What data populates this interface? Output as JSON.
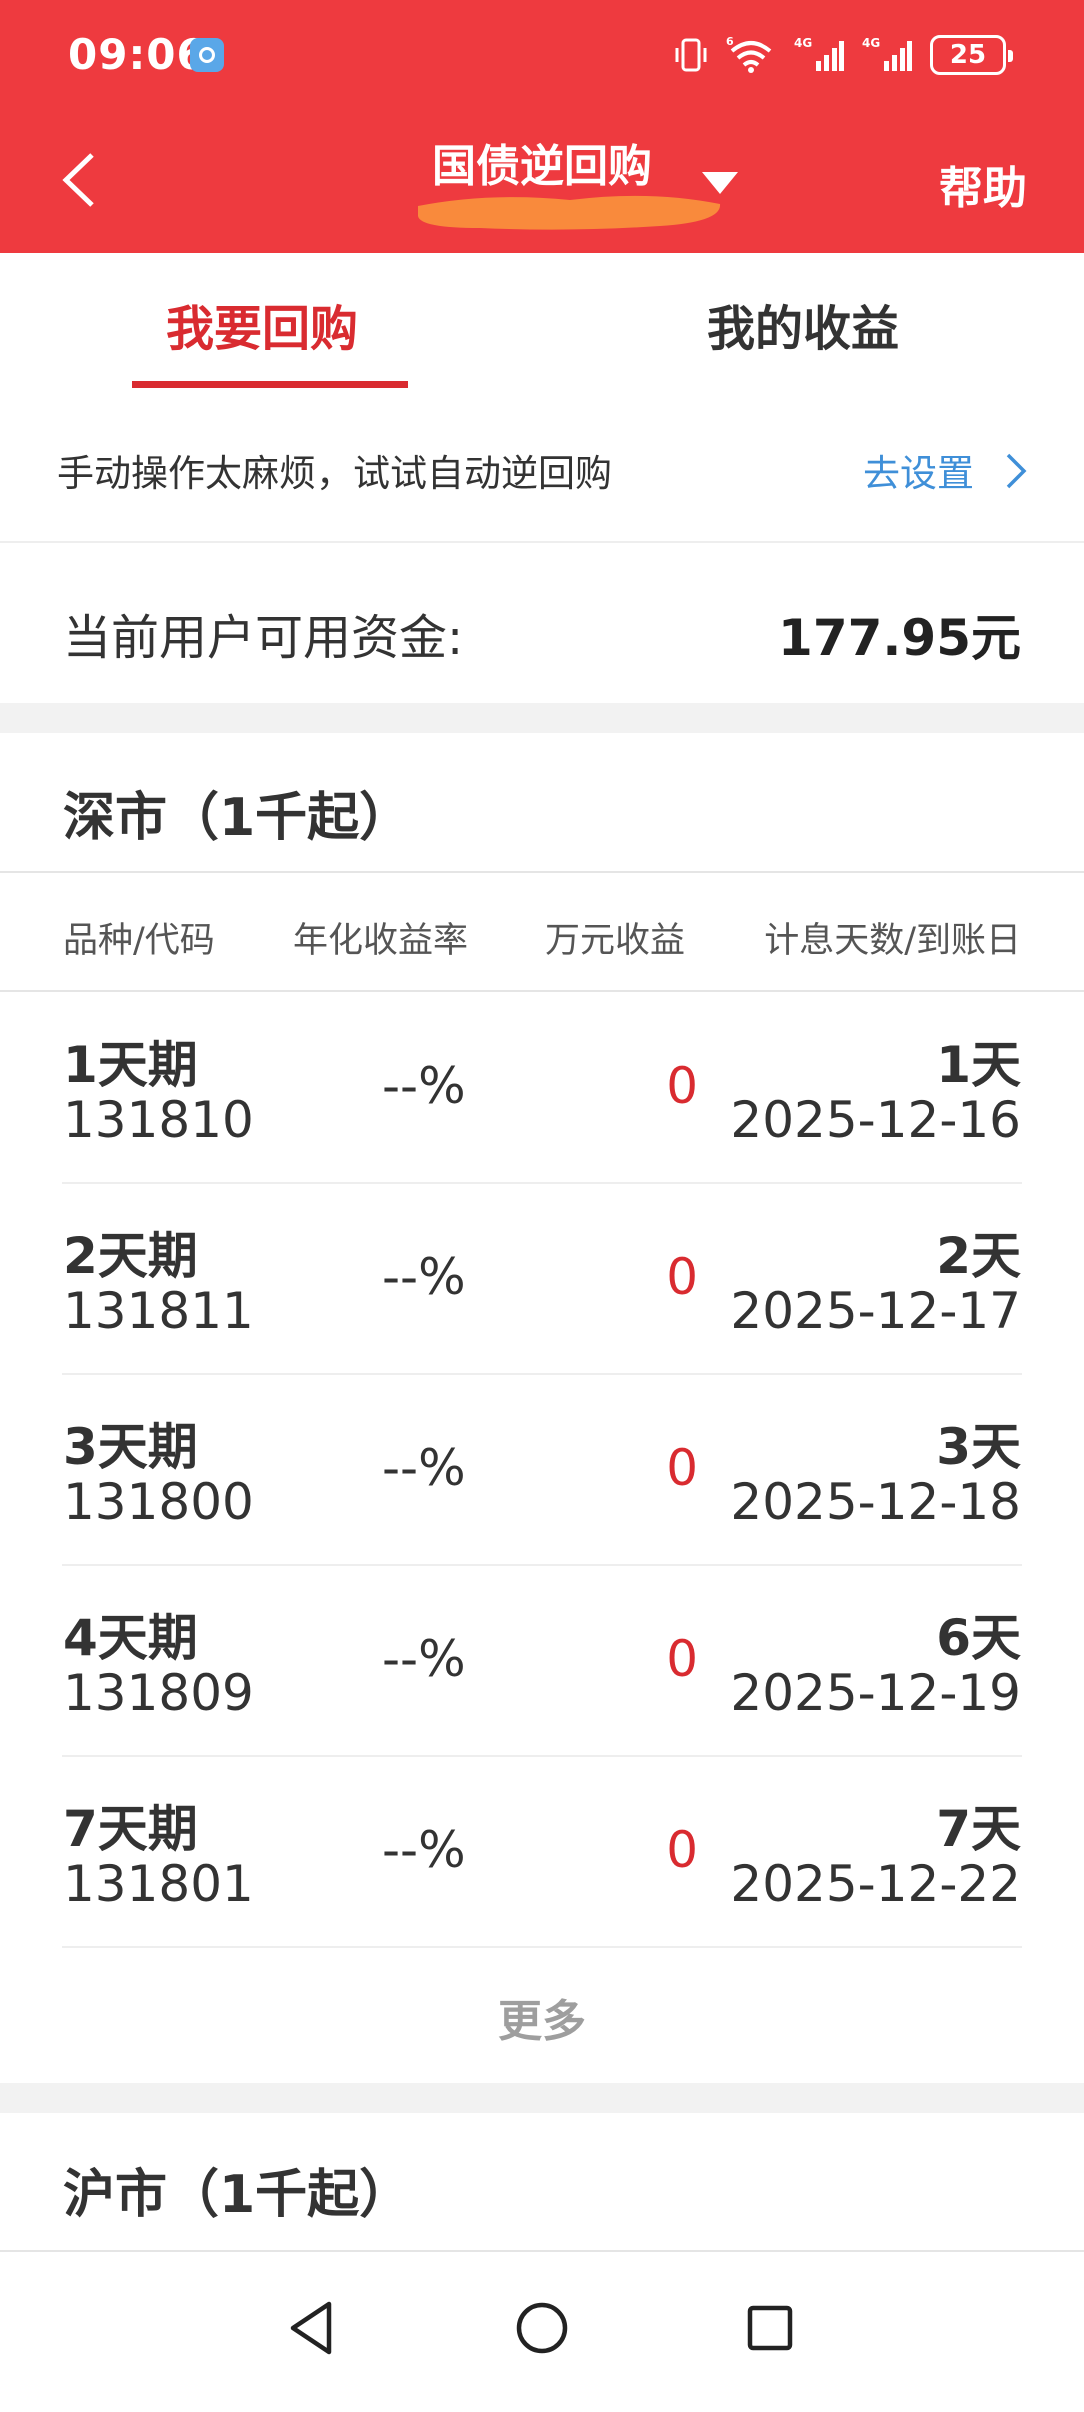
{
  "status_bar": {
    "time": "09:06",
    "signal_label_1": "4G",
    "signal_label_2": "4G",
    "wifi_label": "6",
    "battery": "25"
  },
  "header": {
    "title": "国债逆回购",
    "help_label": "帮助",
    "background_color": "#ee3a3f",
    "redaction_color": "#f98a3c"
  },
  "tabs": [
    {
      "label": "我要回购",
      "active": true
    },
    {
      "label": "我的收益",
      "active": false
    }
  ],
  "banner": {
    "text": "手动操作太麻烦，试试自动逆回购",
    "link_label": "去设置"
  },
  "funds": {
    "label": "当前用户可用资金:",
    "value": "177.95元"
  },
  "shenzhen_market": {
    "title": "深市（1千起）",
    "columns": [
      "品种/代码",
      "年化收益率",
      "万元收益",
      "计息天数/到账日"
    ],
    "rows": [
      {
        "name": "1天期",
        "code": "131810",
        "rate": "--%",
        "income": "0",
        "days": "1天",
        "date": "2025-12-16"
      },
      {
        "name": "2天期",
        "code": "131811",
        "rate": "--%",
        "income": "0",
        "days": "2天",
        "date": "2025-12-17"
      },
      {
        "name": "3天期",
        "code": "131800",
        "rate": "--%",
        "income": "0",
        "days": "3天",
        "date": "2025-12-18"
      },
      {
        "name": "4天期",
        "code": "131809",
        "rate": "--%",
        "income": "0",
        "days": "6天",
        "date": "2025-12-19"
      },
      {
        "name": "7天期",
        "code": "131801",
        "rate": "--%",
        "income": "0",
        "days": "7天",
        "date": "2025-12-22"
      }
    ],
    "more_label": "更多"
  },
  "shanghai_market": {
    "title": "沪市（1千起）"
  },
  "colors": {
    "accent_red": "#d92b30",
    "link_blue": "#3f8fd8"
  },
  "icons": {
    "back": "chevron-left-icon",
    "dropdown": "triangle-down-icon",
    "banner_arrow": "chevron-right-icon",
    "nav_back": "triangle-back-icon",
    "nav_home": "circle-home-icon",
    "nav_recent": "square-recents-icon"
  }
}
